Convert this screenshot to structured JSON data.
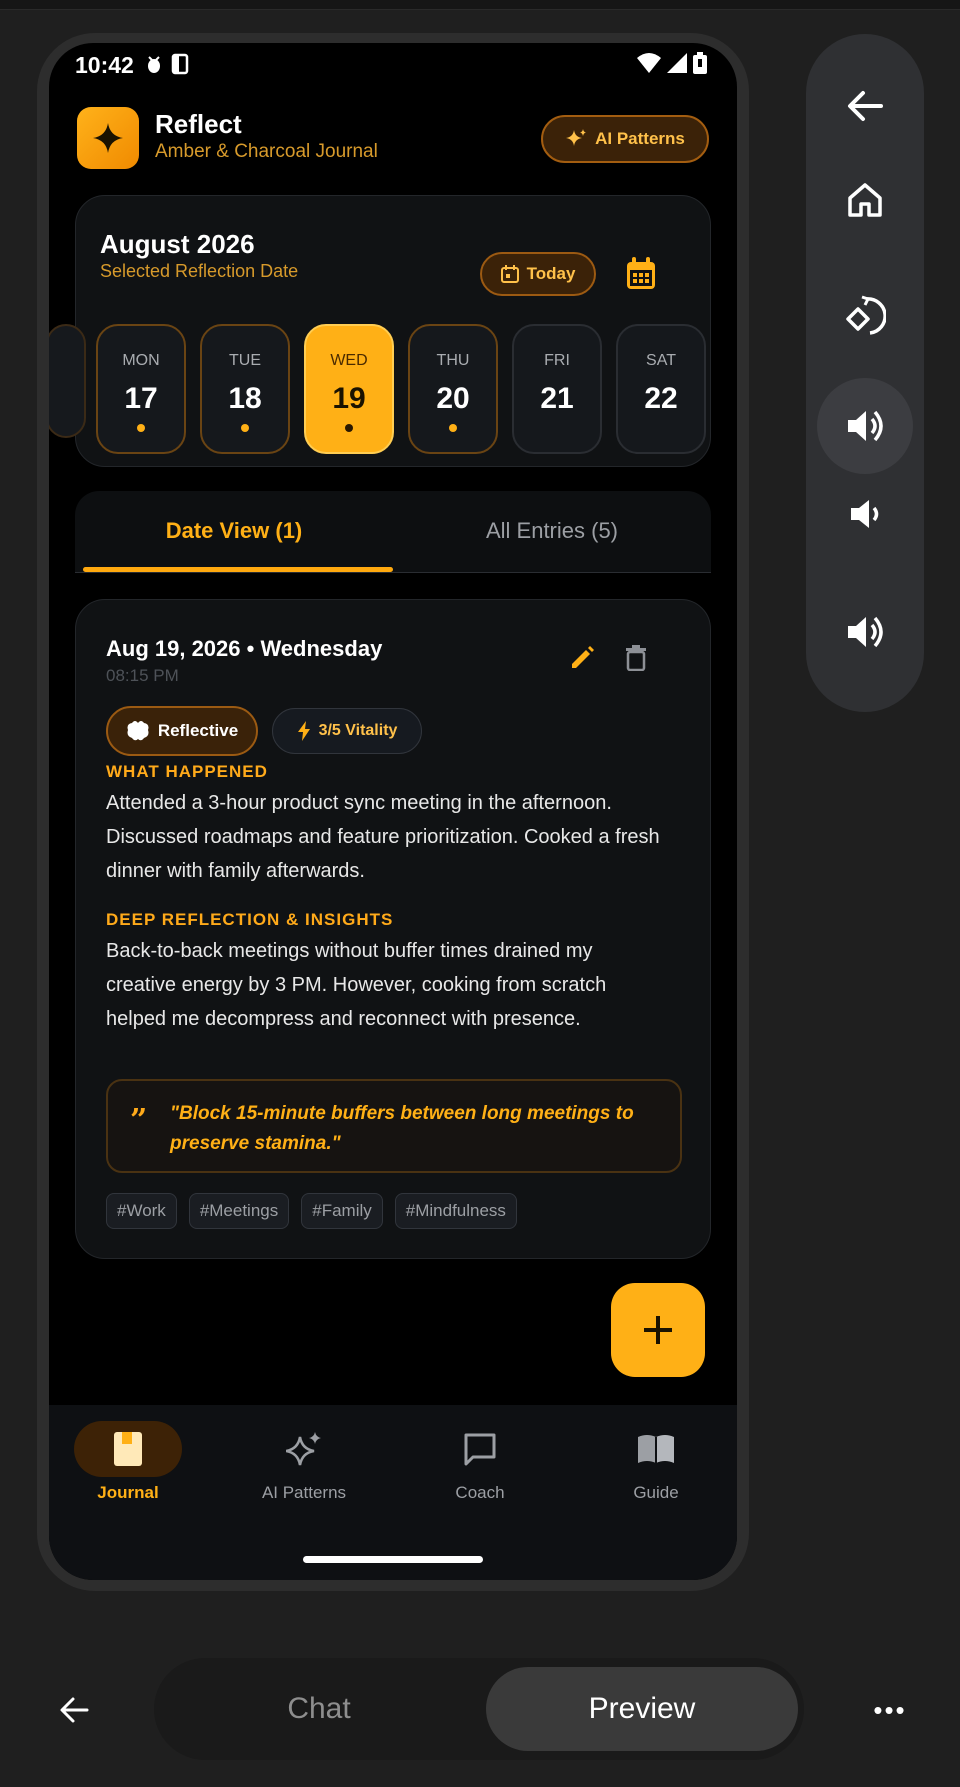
{
  "status_bar": {
    "time": "10:42"
  },
  "app": {
    "title": "Reflect",
    "subtitle": "Amber & Charcoal Journal",
    "ai_patterns_label": "AI Patterns"
  },
  "calendar": {
    "month_title": "August 2026",
    "subtitle": "Selected Reflection Date",
    "today_label": "Today",
    "days": [
      {
        "name": "MON",
        "num": "17",
        "has_entry": true
      },
      {
        "name": "TUE",
        "num": "18",
        "has_entry": true
      },
      {
        "name": "WED",
        "num": "19",
        "has_entry": true,
        "selected": true
      },
      {
        "name": "THU",
        "num": "20",
        "has_entry": true
      },
      {
        "name": "FRI",
        "num": "21",
        "has_entry": false
      },
      {
        "name": "SAT",
        "num": "22",
        "has_entry": false
      }
    ]
  },
  "tabs": {
    "date_view": "Date View (1)",
    "all_entries": "All Entries (5)"
  },
  "entry": {
    "date": "Aug 19, 2026 • Wednesday",
    "time": "08:15 PM",
    "mood": "Reflective",
    "vitality": "3/5 Vitality",
    "what_happened_label": "WHAT HAPPENED",
    "what_happened": "Attended a 3-hour product sync meeting in the afternoon. Discussed roadmaps and feature prioritization. Cooked a fresh dinner with family afterwards.",
    "insights_label": "DEEP REFLECTION & INSIGHTS",
    "insights": "Back-to-back meetings without buffer times drained my creative energy by 3 PM. However, cooking from scratch helped me decompress and reconnect with presence.",
    "quote": "\"Block 15-minute buffers between long meetings to preserve stamina.\"",
    "tags": [
      "#Work",
      "#Meetings",
      "#Family",
      "#Mindfulness"
    ]
  },
  "bottom_nav": [
    {
      "label": "Journal",
      "icon": "journal-icon",
      "active": true
    },
    {
      "label": "AI Patterns",
      "icon": "sparkle-icon",
      "active": false
    },
    {
      "label": "Coach",
      "icon": "chat-icon",
      "active": false
    },
    {
      "label": "Guide",
      "icon": "book-icon",
      "active": false
    }
  ],
  "emulator_bar": {
    "chat_label": "Chat",
    "preview_label": "Preview"
  },
  "colors": {
    "accent": "#ffb016",
    "background": "#000000",
    "card": "#101214"
  }
}
